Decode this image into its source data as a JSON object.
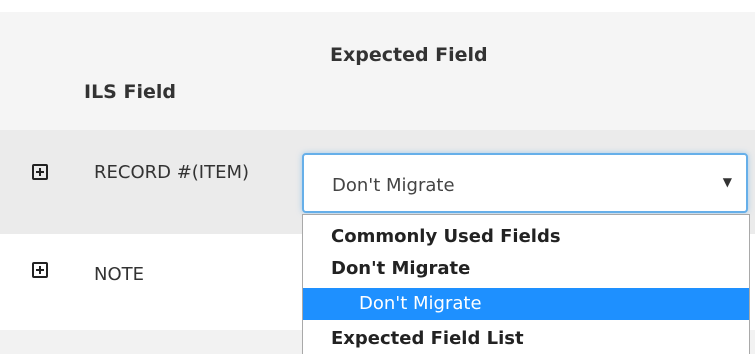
{
  "table": {
    "headers": {
      "ils_field": "ILS Field",
      "expected_field": "Expected Field"
    },
    "rows": [
      {
        "ils_field": "RECORD #(ITEM)",
        "expected_value": "Don't Migrate"
      },
      {
        "ils_field": "NOTE"
      }
    ]
  },
  "dropdown": {
    "options": [
      {
        "label": "Commonly Used Fields",
        "kind": "group"
      },
      {
        "label": "Don't Migrate",
        "kind": "group"
      },
      {
        "label": "Don't Migrate",
        "kind": "option",
        "selected": true
      },
      {
        "label": "Expected Field List",
        "kind": "group"
      }
    ]
  },
  "colors": {
    "highlight": "#1e90ff",
    "focus_border": "#66afe9",
    "row_shade": "#ebebeb"
  },
  "icons": {
    "expand": "plus-square-icon",
    "caret": "caret-down-icon"
  }
}
